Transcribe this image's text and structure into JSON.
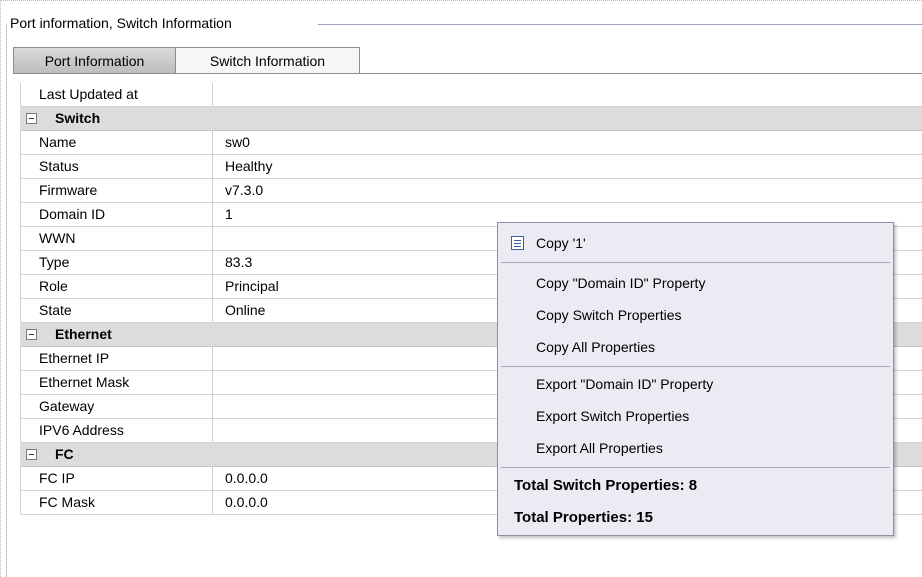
{
  "group_title": "Port information, Switch Information",
  "tabs": [
    {
      "label": "Port Information",
      "selected": false
    },
    {
      "label": "Switch Information",
      "selected": true
    }
  ],
  "properties": {
    "last_updated": {
      "name": "Last Updated at",
      "value": ""
    },
    "switch_section": "Switch",
    "switch": [
      {
        "name": "Name",
        "value": "sw0"
      },
      {
        "name": "Status",
        "value": "Healthy"
      },
      {
        "name": "Firmware",
        "value": "v7.3.0"
      },
      {
        "name": "Domain ID",
        "value": "1"
      },
      {
        "name": "WWN",
        "value": ""
      },
      {
        "name": "Type",
        "value": "83.3"
      },
      {
        "name": "Role",
        "value": "Principal"
      },
      {
        "name": "State",
        "value": "Online"
      }
    ],
    "ethernet_section": "Ethernet",
    "ethernet": [
      {
        "name": "Ethernet IP",
        "value": ""
      },
      {
        "name": "Ethernet Mask",
        "value": ""
      },
      {
        "name": "Gateway",
        "value": ""
      },
      {
        "name": "IPV6 Address",
        "value": ""
      }
    ],
    "fc_section": "FC",
    "fc": [
      {
        "name": "FC IP",
        "value": "0.0.0.0"
      },
      {
        "name": "FC Mask",
        "value": "0.0.0.0"
      }
    ]
  },
  "context_menu": {
    "copy_value": "Copy '1'",
    "copy_property": "Copy \"Domain ID\" Property",
    "copy_switch": "Copy Switch Properties",
    "copy_all": "Copy All Properties",
    "export_property": "Export \"Domain ID\" Property",
    "export_switch": "Export Switch Properties",
    "export_all": "Export All Properties",
    "total_switch": "Total Switch Properties: 8",
    "total_all": "Total Properties: 15"
  },
  "icons": {
    "copy": "copy-icon",
    "collapse": "collapse-icon"
  },
  "colors": {
    "section_background": "#dcdcdc",
    "menu_background": "#ecebf3",
    "icon_blue": "#3c5fa6"
  }
}
